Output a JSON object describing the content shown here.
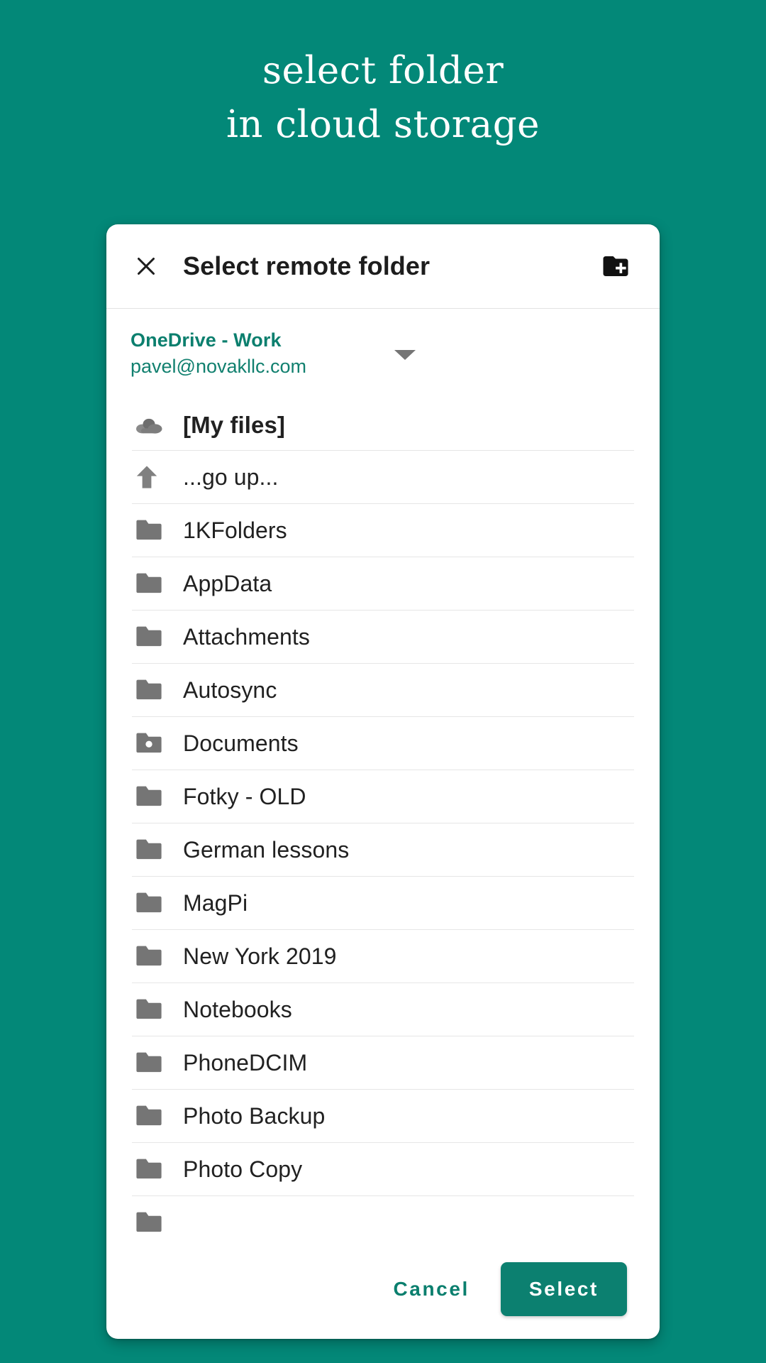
{
  "promo": {
    "line1": "select folder",
    "line2": "in cloud storage"
  },
  "colors": {
    "background_teal": "#038878",
    "accent_teal": "#0b7f6e",
    "button_teal": "#0c8070",
    "folder_gray": "#757575",
    "text_dark": "#212121"
  },
  "dialog": {
    "title": "Select remote folder",
    "close_icon": "close-icon",
    "new_folder_icon": "create-new-folder-icon"
  },
  "account": {
    "name": "OneDrive - Work",
    "email": "pavel@novakllc.com",
    "caret_icon": "chevron-down-icon"
  },
  "list": {
    "root": {
      "label": "[My files]",
      "icon": "cloud-icon"
    },
    "go_up": {
      "label": "...go up...",
      "icon": "arrow-up-icon"
    },
    "folders": [
      {
        "label": "1KFolders",
        "icon": "folder-icon"
      },
      {
        "label": "AppData",
        "icon": "folder-icon"
      },
      {
        "label": "Attachments",
        "icon": "folder-icon"
      },
      {
        "label": "Autosync",
        "icon": "folder-icon"
      },
      {
        "label": "Documents",
        "icon": "folder-shared-icon"
      },
      {
        "label": "Fotky - OLD",
        "icon": "folder-icon"
      },
      {
        "label": "German lessons",
        "icon": "folder-icon"
      },
      {
        "label": "MagPi",
        "icon": "folder-icon"
      },
      {
        "label": "New York 2019",
        "icon": "folder-icon"
      },
      {
        "label": "Notebooks",
        "icon": "folder-icon"
      },
      {
        "label": "PhoneDCIM",
        "icon": "folder-icon"
      },
      {
        "label": "Photo Backup",
        "icon": "folder-icon"
      },
      {
        "label": "Photo Copy",
        "icon": "folder-icon"
      },
      {
        "label": "",
        "icon": "folder-icon"
      }
    ]
  },
  "footer": {
    "cancel_label": "Cancel",
    "select_label": "Select"
  }
}
